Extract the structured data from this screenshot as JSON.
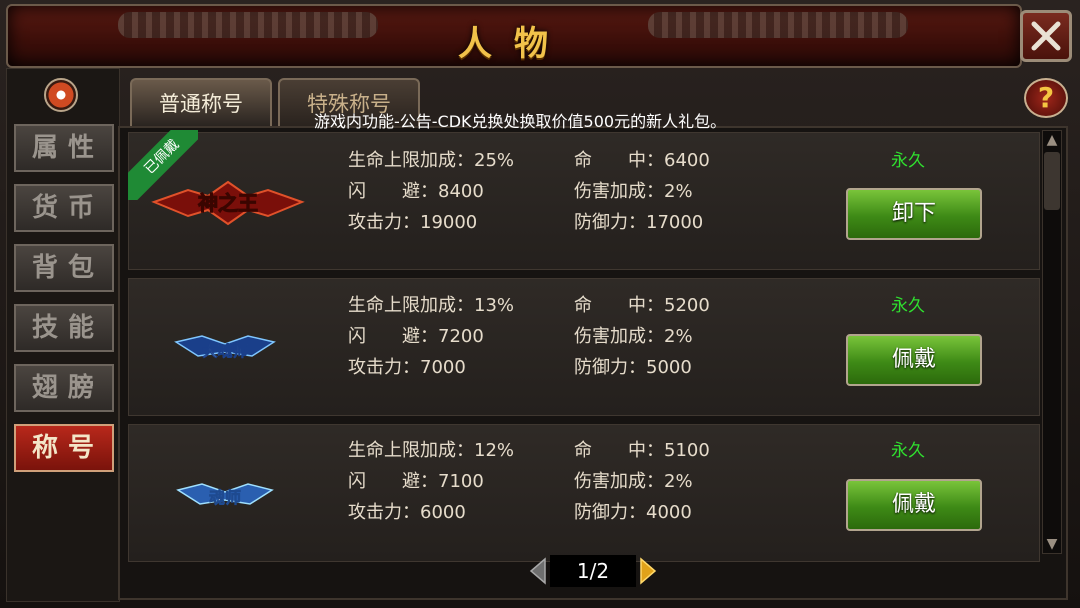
{
  "header": {
    "title": "人物"
  },
  "sidebar": {
    "items": [
      {
        "label": "属性",
        "active": false
      },
      {
        "label": "货币",
        "active": false
      },
      {
        "label": "背包",
        "active": false
      },
      {
        "label": "技能",
        "active": false
      },
      {
        "label": "翅膀",
        "active": false
      },
      {
        "label": "称号",
        "active": true
      }
    ]
  },
  "tabs": [
    {
      "label": "普通称号",
      "active": true
    },
    {
      "label": "特殊称号",
      "active": false
    }
  ],
  "help_label": "?",
  "notice": "游戏内功能-公告-CDK兑换处换取价值500元的新人礼包。",
  "titles": [
    {
      "badge": "已佩戴",
      "art_text": "神之王",
      "hp_bonus_label": "生命上限加成：",
      "hp_bonus": "25%",
      "dodge_label": "闪　　避：",
      "dodge": "8400",
      "attack_label": "攻击力：",
      "attack": "19000",
      "hit_label": "命　　中：",
      "hit": "6400",
      "damage_label": "伤害加成：",
      "damage": "2%",
      "defense_label": "防御力：",
      "defense": "17000",
      "duration": "永久",
      "action": "卸下"
    },
    {
      "badge": "",
      "art_text": "大魂师",
      "hp_bonus_label": "生命上限加成：",
      "hp_bonus": "13%",
      "dodge_label": "闪　　避：",
      "dodge": "7200",
      "attack_label": "攻击力：",
      "attack": "7000",
      "hit_label": "命　　中：",
      "hit": "5200",
      "damage_label": "伤害加成：",
      "damage": "2%",
      "defense_label": "防御力：",
      "defense": "5000",
      "duration": "永久",
      "action": "佩戴"
    },
    {
      "badge": "",
      "art_text": "魂师",
      "hp_bonus_label": "生命上限加成：",
      "hp_bonus": "12%",
      "dodge_label": "闪　　避：",
      "dodge": "7100",
      "attack_label": "攻击力：",
      "attack": "6000",
      "hit_label": "命　　中：",
      "hit": "5100",
      "damage_label": "伤害加成：",
      "damage": "2%",
      "defense_label": "防御力：",
      "defense": "4000",
      "duration": "永久",
      "action": "佩戴"
    }
  ],
  "pager": {
    "label": "1/2"
  },
  "colors": {
    "accent_gold": "#f1c24a",
    "duration_green": "#2fe02f",
    "button_green": "#4e9a22",
    "active_tab_red": "#b8281b"
  },
  "icons": [
    "close-icon",
    "record-icon",
    "help-icon",
    "prev-page-icon",
    "next-page-icon",
    "scroll-up-icon",
    "scroll-down-icon"
  ]
}
